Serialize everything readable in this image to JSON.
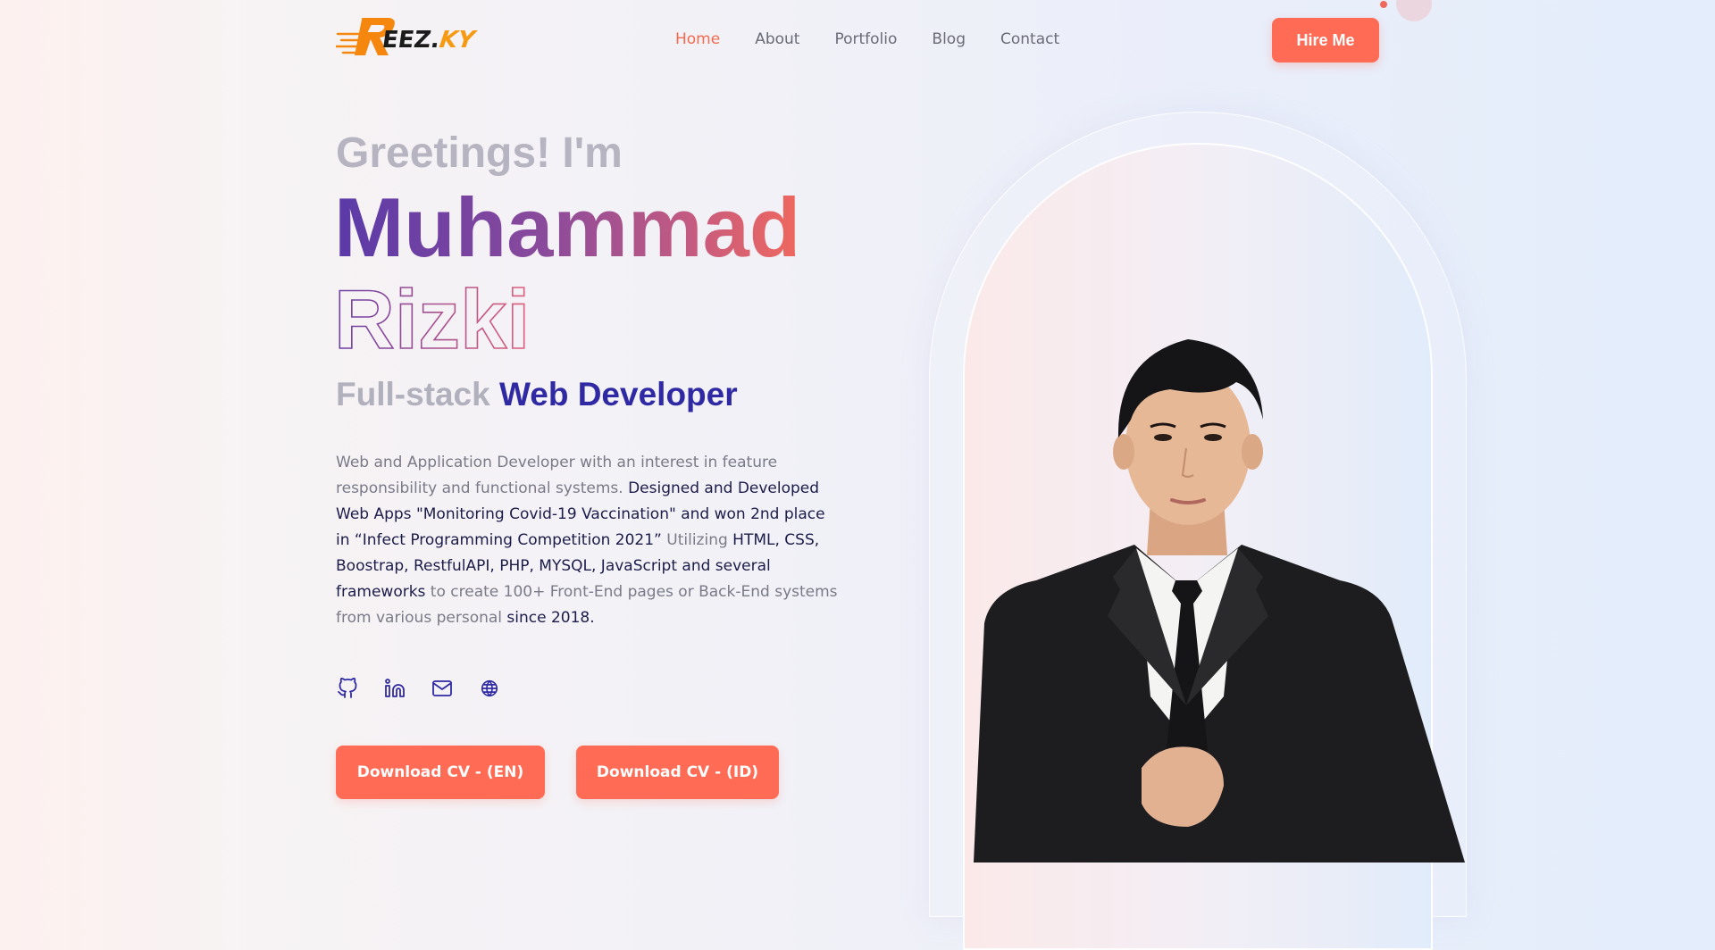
{
  "header": {
    "logo": {
      "brand": "REEZ.KY",
      "mark": "R",
      "text_dark": "EEZ.",
      "text_accent": "KY"
    },
    "nav": [
      {
        "label": "Home",
        "active": true
      },
      {
        "label": "About",
        "active": false
      },
      {
        "label": "Portfolio",
        "active": false
      },
      {
        "label": "Blog",
        "active": false
      },
      {
        "label": "Contact",
        "active": false
      }
    ],
    "hire_button": "Hire Me"
  },
  "hero": {
    "greeting": "Greetings! I'm",
    "first_name": "Muhammad",
    "last_name": "Rizki",
    "role_prefix": "Full-stack",
    "role_main": "Web Developer",
    "bio": {
      "p1": "Web and Application Developer with an interest in feature responsibility and functional systems. ",
      "p2": "Designed and Developed Web Apps \"Monitoring Covid-19 Vaccination\" and won 2nd place in “Infect Programming Competition 2021”",
      "p3": " Utilizing ",
      "p4": "HTML, CSS, Boostrap, RestfulAPI, PHP, MYSQL, JavaScript and several frameworks",
      "p5": " to create 100+ Front-End pages or Back-End systems from various personal ",
      "p6": "since 2018."
    },
    "socials": [
      {
        "icon": "github-icon"
      },
      {
        "icon": "linkedin-icon"
      },
      {
        "icon": "mail-icon"
      },
      {
        "icon": "globe-icon"
      }
    ],
    "cv_en": "Download CV - (EN)",
    "cv_id": "Download CV - (ID)"
  },
  "colors": {
    "accent": "#ff6b55",
    "nav_active": "#f26b50",
    "role_strong": "#2f2aa3",
    "icon": "#2f2aa3"
  }
}
